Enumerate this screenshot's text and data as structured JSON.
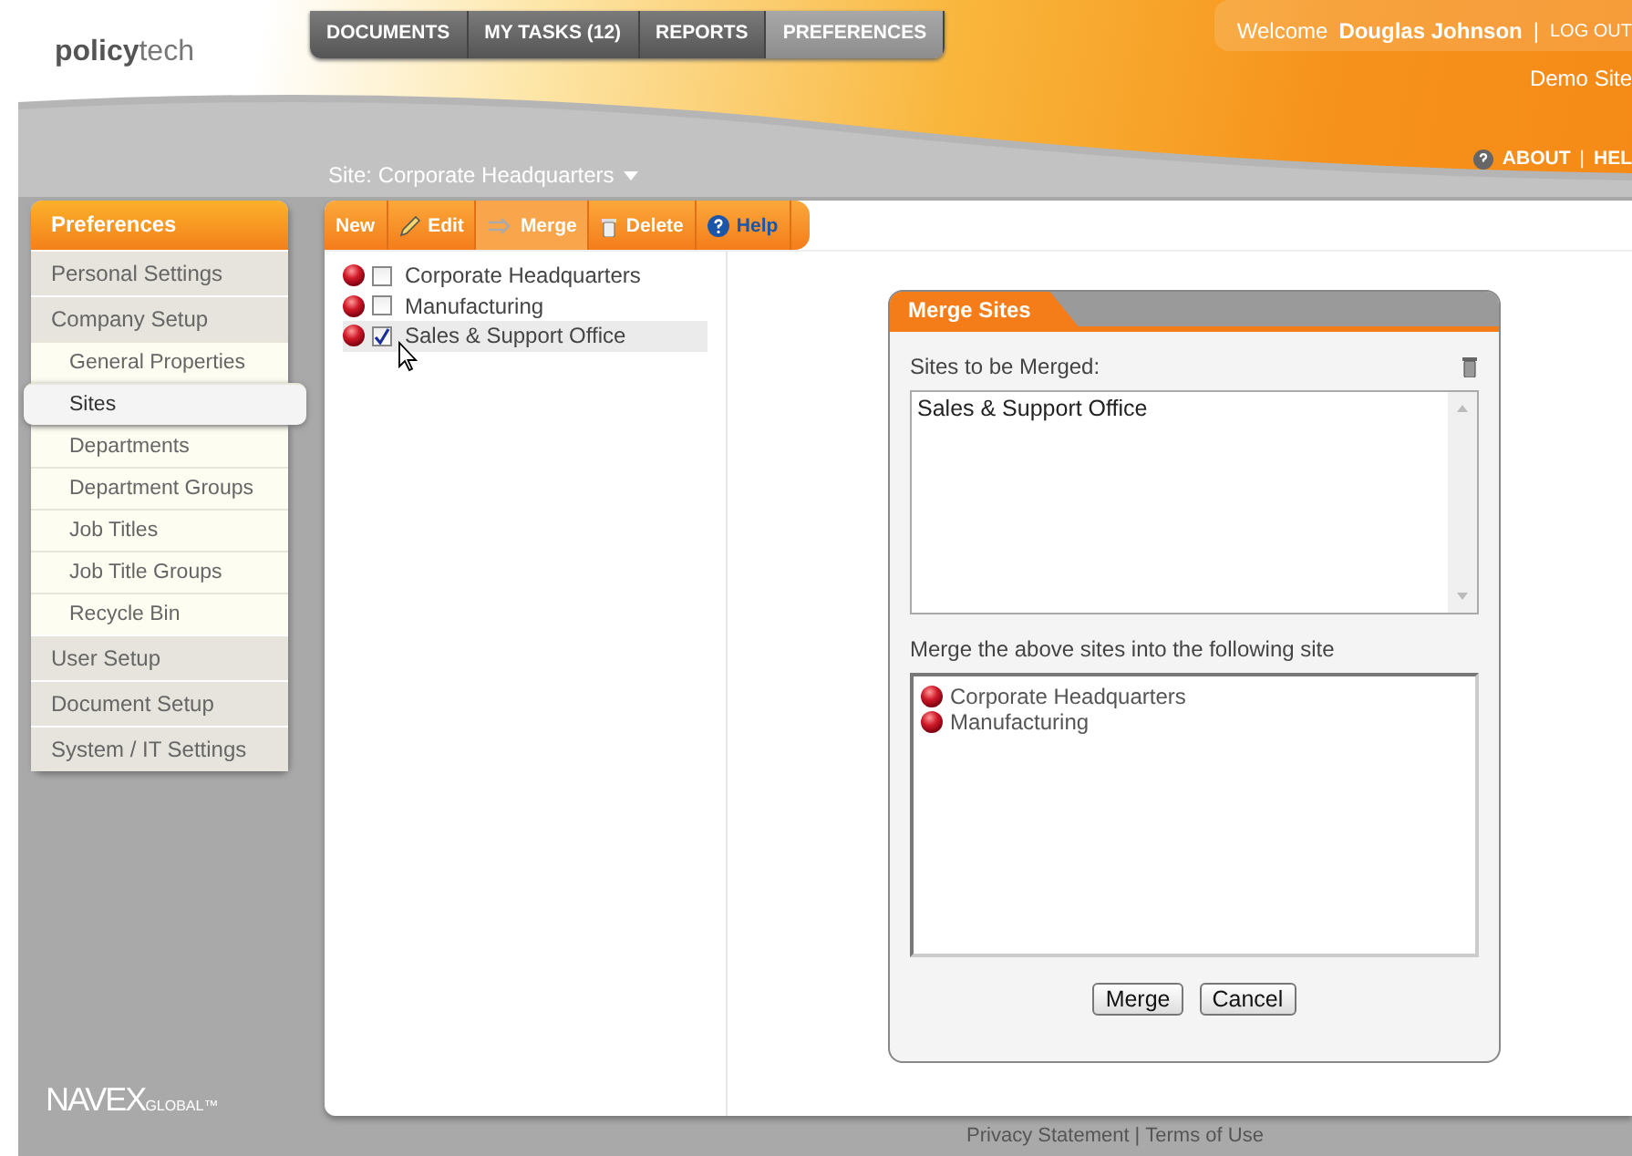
{
  "logo": {
    "main": "policy",
    "accent": "tech"
  },
  "nav_tabs": [
    {
      "label": "DOCUMENTS",
      "selected": false
    },
    {
      "label": "MY TASKS (12)",
      "selected": false
    },
    {
      "label": "REPORTS",
      "selected": false
    },
    {
      "label": "PREFERENCES",
      "selected": true
    }
  ],
  "welcome": {
    "prefix": "Welcome",
    "user": "Douglas Johnson",
    "separator": "|",
    "logout": "LOG OUT"
  },
  "site_name": "Demo Site",
  "header_links": {
    "about": "ABOUT",
    "separator": "|",
    "help": "HEL"
  },
  "site_selector": "Site: Corporate Headquarters",
  "sidebar": {
    "title": "Preferences",
    "items": [
      {
        "label": "Personal Settings",
        "selected": false
      },
      {
        "label": "Company Setup",
        "selected": false,
        "children": [
          {
            "label": "General Properties",
            "selected": false
          },
          {
            "label": "Sites",
            "selected": true
          },
          {
            "label": "Departments",
            "selected": false
          },
          {
            "label": "Department Groups",
            "selected": false
          },
          {
            "label": "Job Titles",
            "selected": false
          },
          {
            "label": "Job Title Groups",
            "selected": false
          },
          {
            "label": "Recycle Bin",
            "selected": false
          }
        ]
      },
      {
        "label": "User Setup",
        "selected": false
      },
      {
        "label": "Document Setup",
        "selected": false
      },
      {
        "label": "System / IT Settings",
        "selected": false
      }
    ]
  },
  "toolbar": [
    {
      "label": "New",
      "kind": "plain",
      "selected": false
    },
    {
      "label": "Edit",
      "kind": "edit",
      "selected": false
    },
    {
      "label": "Merge",
      "kind": "merge",
      "selected": true
    },
    {
      "label": "Delete",
      "kind": "delete",
      "selected": false
    },
    {
      "label": "Help",
      "kind": "help",
      "selected": false
    }
  ],
  "sites": [
    {
      "label": "Corporate Headquarters",
      "checked": false
    },
    {
      "label": "Manufacturing",
      "checked": false
    },
    {
      "label": "Sales & Support Office",
      "checked": true
    }
  ],
  "dialog": {
    "title": "Merge Sites",
    "merged_label": "Sites to be Merged:",
    "merged_items": [
      "Sales & Support Office"
    ],
    "target_label": "Merge the above sites into the following site",
    "targets": [
      "Corporate Headquarters",
      "Manufacturing"
    ],
    "buttons": [
      "Merge",
      "Cancel"
    ]
  },
  "brand": {
    "main": "NAVEX",
    "sub": "GLOBAL™"
  },
  "footer": {
    "privacy": "Privacy Statement",
    "separator": "|",
    "terms": "Terms of Use"
  }
}
